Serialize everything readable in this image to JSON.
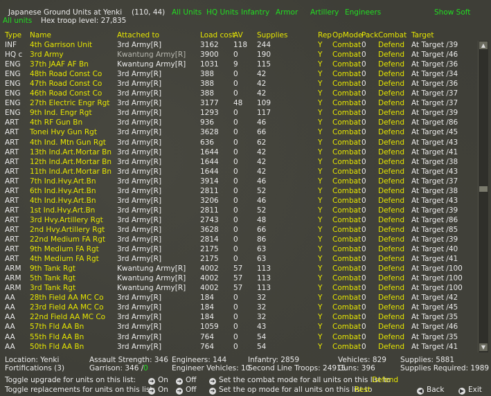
{
  "header": {
    "title": "Japanese Ground Units at Yenki",
    "coords": "(110, 44)",
    "all_units": "All units",
    "hex_troop_level": "Hex troop level: 27,835",
    "filters": [
      "All Units",
      "HQ Units",
      "Infantry",
      "Armor",
      "Artillery",
      "Engineers"
    ],
    "show_soft": "Show Soft"
  },
  "columns": [
    "Type",
    "Name",
    "Attached to",
    "Load cost",
    "AV",
    "Supplies",
    "Rep",
    "OpMode",
    "Pack",
    "Combat",
    "Target"
  ],
  "rows": [
    [
      "INF",
      "4th Garrison Unit",
      "3rd Army[R]",
      "3162",
      "118",
      "244",
      "Y",
      "Combat",
      "0",
      "Defend",
      "At Target /39"
    ],
    [
      "HQ c",
      "3rd Army",
      "Kwantung Army[R]",
      "3900",
      "0",
      "190",
      "Y",
      "Combat",
      "0",
      "Defend",
      "At Target /46"
    ],
    [
      "ENG",
      "37th JAAF AF Bn",
      "Kwantung Army[R]",
      "1031",
      "9",
      "115",
      "Y",
      "Combat",
      "0",
      "Defend",
      "At Target /36"
    ],
    [
      "ENG",
      "48th Road Const Co",
      "3rd Army[R]",
      "388",
      "0",
      "42",
      "Y",
      "Combat",
      "0",
      "Defend",
      "At Target /34"
    ],
    [
      "ENG",
      "47th Road Const Co",
      "3rd Army[R]",
      "388",
      "0",
      "42",
      "Y",
      "Combat",
      "0",
      "Defend",
      "At Target /36"
    ],
    [
      "ENG",
      "46th Road Const Co",
      "3rd Army[R]",
      "388",
      "0",
      "42",
      "Y",
      "Combat",
      "0",
      "Defend",
      "At Target /37"
    ],
    [
      "ENG",
      "27th Electric Engr Rgt",
      "3rd Army[R]",
      "3177",
      "48",
      "109",
      "Y",
      "Combat",
      "0",
      "Defend",
      "At Target /37"
    ],
    [
      "ENG",
      "9th Ind. Engr Rgt",
      "3rd Army[R]",
      "1293",
      "0",
      "117",
      "Y",
      "Combat",
      "0",
      "Defend",
      "At Target /39"
    ],
    [
      "ART",
      "4th RF Gun Bn",
      "3rd Army[R]",
      "936",
      "0",
      "46",
      "Y",
      "Combat",
      "0",
      "Defend",
      "At Target /86"
    ],
    [
      "ART",
      "Tonei Hvy Gun Rgt",
      "3rd Army[R]",
      "3628",
      "0",
      "66",
      "Y",
      "Combat",
      "0",
      "Defend",
      "At Target /45"
    ],
    [
      "ART",
      "4th Ind. Mtn Gun Rgt",
      "3rd Army[R]",
      "636",
      "0",
      "62",
      "Y",
      "Combat",
      "0",
      "Defend",
      "At Target /43"
    ],
    [
      "ART",
      "13th Ind.Art.Mortar Bn",
      "3rd Army[R]",
      "1644",
      "0",
      "42",
      "Y",
      "Combat",
      "0",
      "Defend",
      "At Target /41"
    ],
    [
      "ART",
      "12th Ind.Art.Mortar Bn",
      "3rd Army[R]",
      "1644",
      "0",
      "42",
      "Y",
      "Combat",
      "0",
      "Defend",
      "At Target /38"
    ],
    [
      "ART",
      "11th Ind.Art.Mortar Bn",
      "3rd Army[R]",
      "1644",
      "0",
      "42",
      "Y",
      "Combat",
      "0",
      "Defend",
      "At Target /43"
    ],
    [
      "ART",
      "7th Ind.Hvy.Art.Bn",
      "3rd Army[R]",
      "3914",
      "0",
      "46",
      "Y",
      "Combat",
      "0",
      "Defend",
      "At Target /37"
    ],
    [
      "ART",
      "6th Ind.Hvy.Art.Bn",
      "3rd Army[R]",
      "2811",
      "0",
      "52",
      "Y",
      "Combat",
      "0",
      "Defend",
      "At Target /38"
    ],
    [
      "ART",
      "4th Ind.Hvy.Art.Bn",
      "3rd Army[R]",
      "3206",
      "0",
      "46",
      "Y",
      "Combat",
      "0",
      "Defend",
      "At Target /43"
    ],
    [
      "ART",
      "1st Ind.Hvy.Art.Bn",
      "3rd Army[R]",
      "2811",
      "0",
      "52",
      "Y",
      "Combat",
      "0",
      "Defend",
      "At Target /39"
    ],
    [
      "ART",
      "3rd Hvy.Artillery Rgt",
      "3rd Army[R]",
      "2743",
      "0",
      "48",
      "Y",
      "Combat",
      "0",
      "Defend",
      "At Target /86"
    ],
    [
      "ART",
      "2nd Hvy.Artillery Rgt",
      "3rd Army[R]",
      "3628",
      "0",
      "66",
      "Y",
      "Combat",
      "0",
      "Defend",
      "At Target /85"
    ],
    [
      "ART",
      "22nd Medium FA Rgt",
      "3rd Army[R]",
      "2814",
      "0",
      "86",
      "Y",
      "Combat",
      "0",
      "Defend",
      "At Target /39"
    ],
    [
      "ART",
      "9th Medium FA Rgt",
      "3rd Army[R]",
      "2175",
      "0",
      "63",
      "Y",
      "Combat",
      "0",
      "Defend",
      "At Target /40"
    ],
    [
      "ART",
      "4th Medium FA Rgt",
      "3rd Army[R]",
      "2175",
      "0",
      "63",
      "Y",
      "Combat",
      "0",
      "Defend",
      "At Target /41"
    ],
    [
      "ARM",
      "9th Tank Rgt",
      "Kwantung Army[R]",
      "4002",
      "57",
      "113",
      "Y",
      "Combat",
      "0",
      "Defend",
      "At Target /100"
    ],
    [
      "ARM",
      "5th Tank Rgt",
      "Kwantung Army[R]",
      "4002",
      "57",
      "113",
      "Y",
      "Combat",
      "0",
      "Defend",
      "At Target /100"
    ],
    [
      "ARM",
      "3rd Tank Rgt",
      "Kwantung Army[R]",
      "4002",
      "57",
      "113",
      "Y",
      "Combat",
      "0",
      "Defend",
      "At Target /100"
    ],
    [
      "AA",
      "28th Field AA MC Co",
      "3rd Army[R]",
      "184",
      "0",
      "32",
      "Y",
      "Combat",
      "0",
      "Defend",
      "At Target /42"
    ],
    [
      "AA",
      "23rd Field AA MC Co",
      "3rd Army[R]",
      "184",
      "0",
      "32",
      "Y",
      "Combat",
      "0",
      "Defend",
      "At Target /45"
    ],
    [
      "AA",
      "22nd Field AA MC Co",
      "3rd Army[R]",
      "184",
      "0",
      "32",
      "Y",
      "Combat",
      "0",
      "Defend",
      "At Target /35"
    ],
    [
      "AA",
      "57th Fld AA Bn",
      "3rd Army[R]",
      "1059",
      "0",
      "43",
      "Y",
      "Combat",
      "0",
      "Defend",
      "At Target /46"
    ],
    [
      "AA",
      "55th Fld AA Bn",
      "3rd Army[R]",
      "764",
      "0",
      "54",
      "Y",
      "Combat",
      "0",
      "Defend",
      "At Target /35"
    ],
    [
      "AA",
      "50th Fld AA Bn",
      "3rd Army[R]",
      "764",
      "0",
      "54",
      "Y",
      "Combat",
      "0",
      "Defend",
      "At Target /41"
    ]
  ],
  "footer": {
    "location": "Location: Yenki",
    "fortifications": "Fortifications (3)",
    "assault": "Assault Strength: 346",
    "garrison_label": "Garrison: 346 /",
    "garrison_val": "0",
    "engineers": "Engineers: 144",
    "eng_vehicles": "Engineer Vehicles: 10",
    "infantry": "Infantry: 2859",
    "second_line": "Second Line Troops: 24915",
    "vehicles": "Vehicles: 829",
    "guns": "Guns: 396",
    "supplies": "Supplies: 5881",
    "supplies_req": "Supplies Required: 1989",
    "toggle_upgrade": "Toggle upgrade for units on this list:",
    "toggle_repl": "Toggle replacements for units on this list:",
    "on": "On",
    "off": "Off",
    "set_combat": "Set the combat mode for all units on this list to",
    "combat_val": "Defend",
    "set_op": "Set the op mode for all units on this list to",
    "op_val": "Rest",
    "back": "Back",
    "exit": "Exit"
  }
}
